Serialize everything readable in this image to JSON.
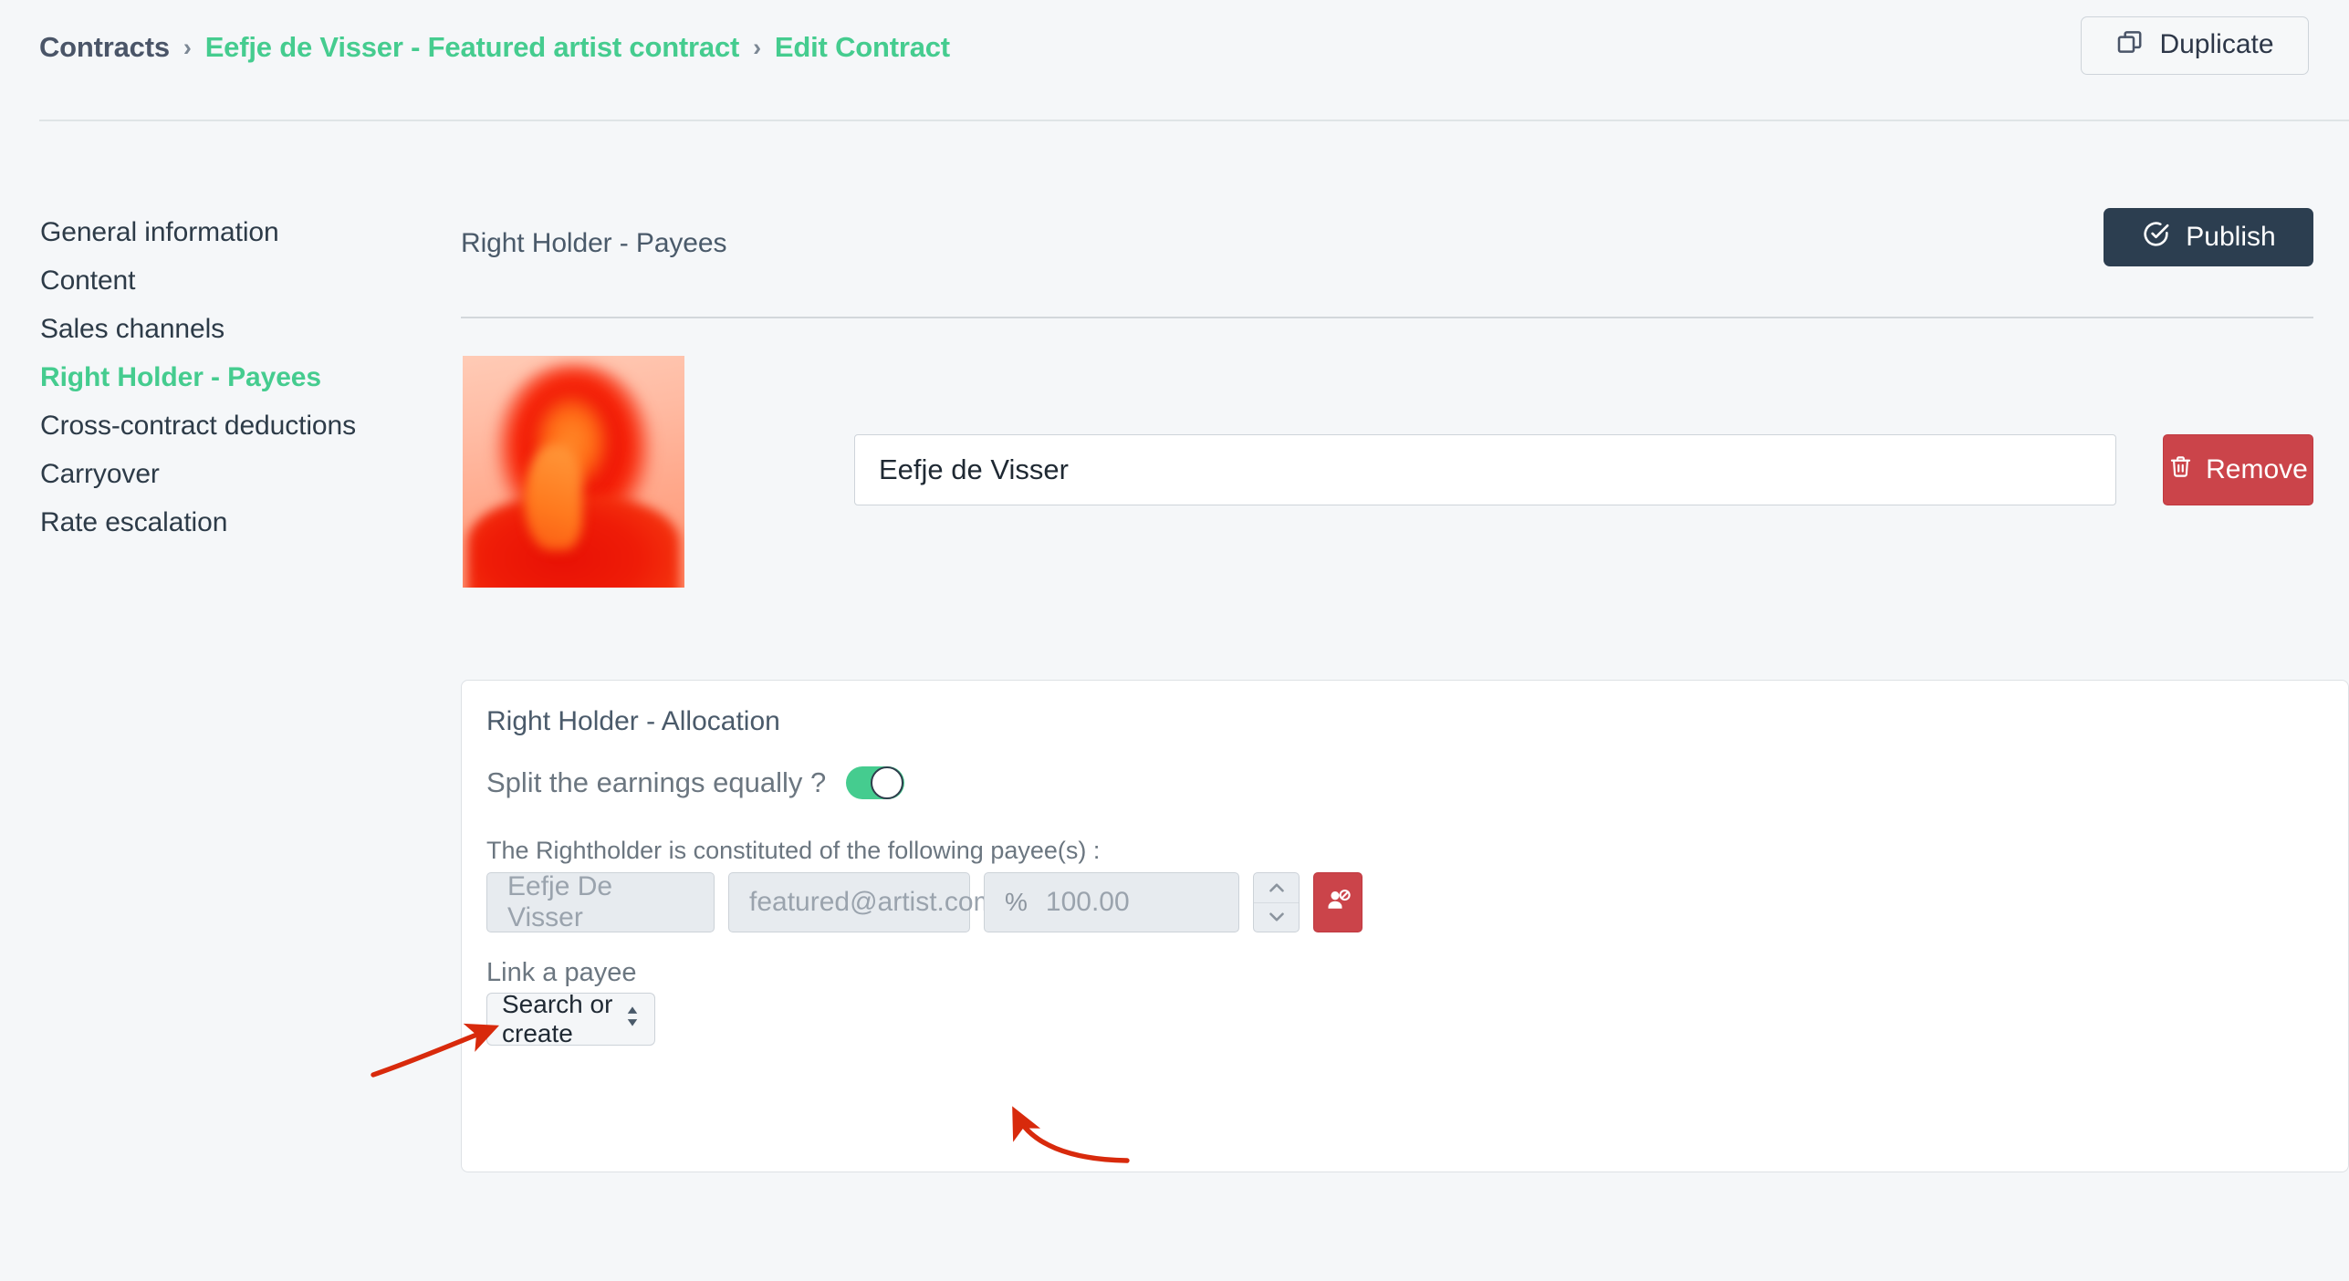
{
  "header": {
    "breadcrumb": {
      "root": "Contracts",
      "contract": "Eefje de Visser - Featured artist contract",
      "current": "Edit Contract",
      "separator": "›"
    },
    "duplicate_button": {
      "label": "Duplicate",
      "icon": "copy-icon"
    }
  },
  "sidebar": {
    "items": [
      {
        "label": "General information",
        "active": false
      },
      {
        "label": "Content",
        "active": false
      },
      {
        "label": "Sales channels",
        "active": false
      },
      {
        "label": "Right Holder - Payees",
        "active": true
      },
      {
        "label": "Cross-contract deductions",
        "active": false
      },
      {
        "label": "Carryover",
        "active": false
      },
      {
        "label": "Rate escalation",
        "active": false
      }
    ]
  },
  "main": {
    "section_title": "Right Holder - Payees",
    "publish_button": {
      "label": "Publish",
      "icon": "check-circle-icon"
    },
    "artist": {
      "photo_alt": "artist-portrait",
      "name_value": "Eefje de Visser",
      "remove_button": {
        "label": "Remove",
        "icon": "trash-icon"
      }
    },
    "allocation": {
      "title": "Right Holder - Allocation",
      "split_label": "Split the earnings equally ?",
      "split_toggle_on": true,
      "payees_hint": "The Rightholder is constituted of the following payee(s) :",
      "payee_row": {
        "name_placeholder": "Eefje De Visser",
        "email_placeholder": "featured@artist.com",
        "percent_symbol": "%",
        "percent_placeholder": "100.00",
        "spinner_up_icon": "chevron-up-icon",
        "spinner_down_icon": "chevron-down-icon",
        "unlink_icon": "user-slash-icon"
      },
      "link_payee_label": "Link a payee",
      "link_payee_select": {
        "selected": "Search or create",
        "icon": "sort-updown-icon"
      }
    }
  },
  "annotations": {
    "arrow_color": "#d82a0c",
    "arrows": [
      {
        "name": "arrow-to-payee-name",
        "points_at": "payee-name-input"
      },
      {
        "name": "arrow-to-payee-email",
        "points_at": "payee-email-input"
      }
    ]
  },
  "colors": {
    "accent_green": "#45cc8f",
    "dark_navy": "#2c3e50",
    "danger_red": "#cb444a",
    "page_bg": "#f5f7f9",
    "annotation_red": "#d82a0c"
  }
}
